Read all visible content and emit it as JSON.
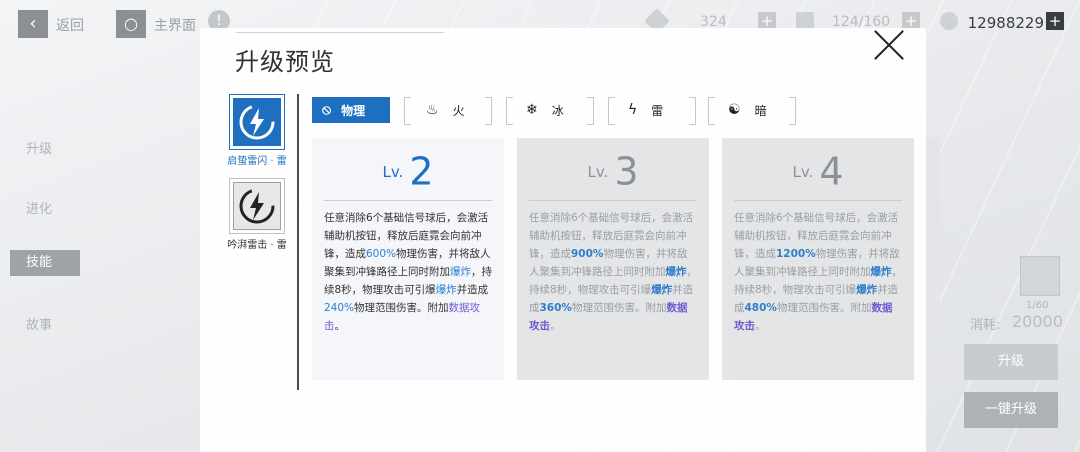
{
  "topbar": {
    "back_label": "返回",
    "home_label": "主界面",
    "stamina": "324",
    "materials": "124/160",
    "credits": "12988229"
  },
  "side_menu": {
    "items": [
      "升级",
      "进化",
      "技能",
      "故事"
    ],
    "active_index": 2
  },
  "right_panel": {
    "item_count": "1/60",
    "cost_label": "消耗:",
    "cost": "20000",
    "upgrade_label": "升级",
    "one_click_label": "一键升级"
  },
  "modal": {
    "title": "升级预览",
    "skills": [
      {
        "label": "启蛰雷闪 · 雷",
        "icon": "lightning-emblem-icon",
        "active": true
      },
      {
        "label": "吟湃雷击 · 雷",
        "icon": "lightning-emblem-icon",
        "active": false
      }
    ],
    "tabs": [
      {
        "label": "物理",
        "icon": "physical-icon",
        "active": true
      },
      {
        "label": "火",
        "icon": "fire-icon",
        "active": false
      },
      {
        "label": "冰",
        "icon": "ice-icon",
        "active": false
      },
      {
        "label": "雷",
        "icon": "lightning-icon",
        "active": false
      },
      {
        "label": "暗",
        "icon": "dark-icon",
        "active": false
      }
    ],
    "cards": [
      {
        "lv_prefix": "Lv.",
        "level": "2",
        "state": "current",
        "d1": "任意消除6个基础信号球后，会激活辅助机按钮，释放后庭霓会向前冲锋，造成",
        "dmg1": "600%",
        "d2": "物理伤害，并将敌人聚集到冲锋路径上同时附加",
        "kw1": "爆炸",
        "d3": "，持续8秒，物理攻击可引爆",
        "kw2": "爆炸",
        "d4": "并造成",
        "dmg2": "240%",
        "d5": "物理范围伤害。附加",
        "kw3": "数据攻击",
        "d6": "。"
      },
      {
        "lv_prefix": "Lv.",
        "level": "3",
        "state": "future",
        "d1": "任意消除6个基础信号球后，会激活辅助机按钮，释放后庭霓会向前冲锋，造成",
        "dmg1": "900%",
        "d2": "物理伤害，并将敌人聚集到冲锋路径上同时附加",
        "kw1": "爆炸",
        "d3": "，持续8秒，物理攻击可引爆",
        "kw2": "爆炸",
        "d4": "并造成",
        "dmg2": "360%",
        "d5": "物理范围伤害。附加",
        "kw3": "数据攻击",
        "d6": "。"
      },
      {
        "lv_prefix": "Lv.",
        "level": "4",
        "state": "future",
        "d1": "任意消除6个基础信号球后，会激活辅助机按钮，释放后庭霓会向前冲锋，造成",
        "dmg1": "1200%",
        "d2": "物理伤害，并将敌人聚集到冲锋路径上同时附加",
        "kw1": "爆炸",
        "d3": "，持续8秒，物理攻击可引爆",
        "kw2": "爆炸",
        "d4": "并造成",
        "dmg2": "480%",
        "d5": "物理范围伤害。附加",
        "kw3": "数据攻击",
        "d6": "。"
      }
    ]
  },
  "colors": {
    "accent": "#1f6fc1",
    "highlight_blue": "#2b7fd4",
    "highlight_purple": "#6c5bd6"
  }
}
